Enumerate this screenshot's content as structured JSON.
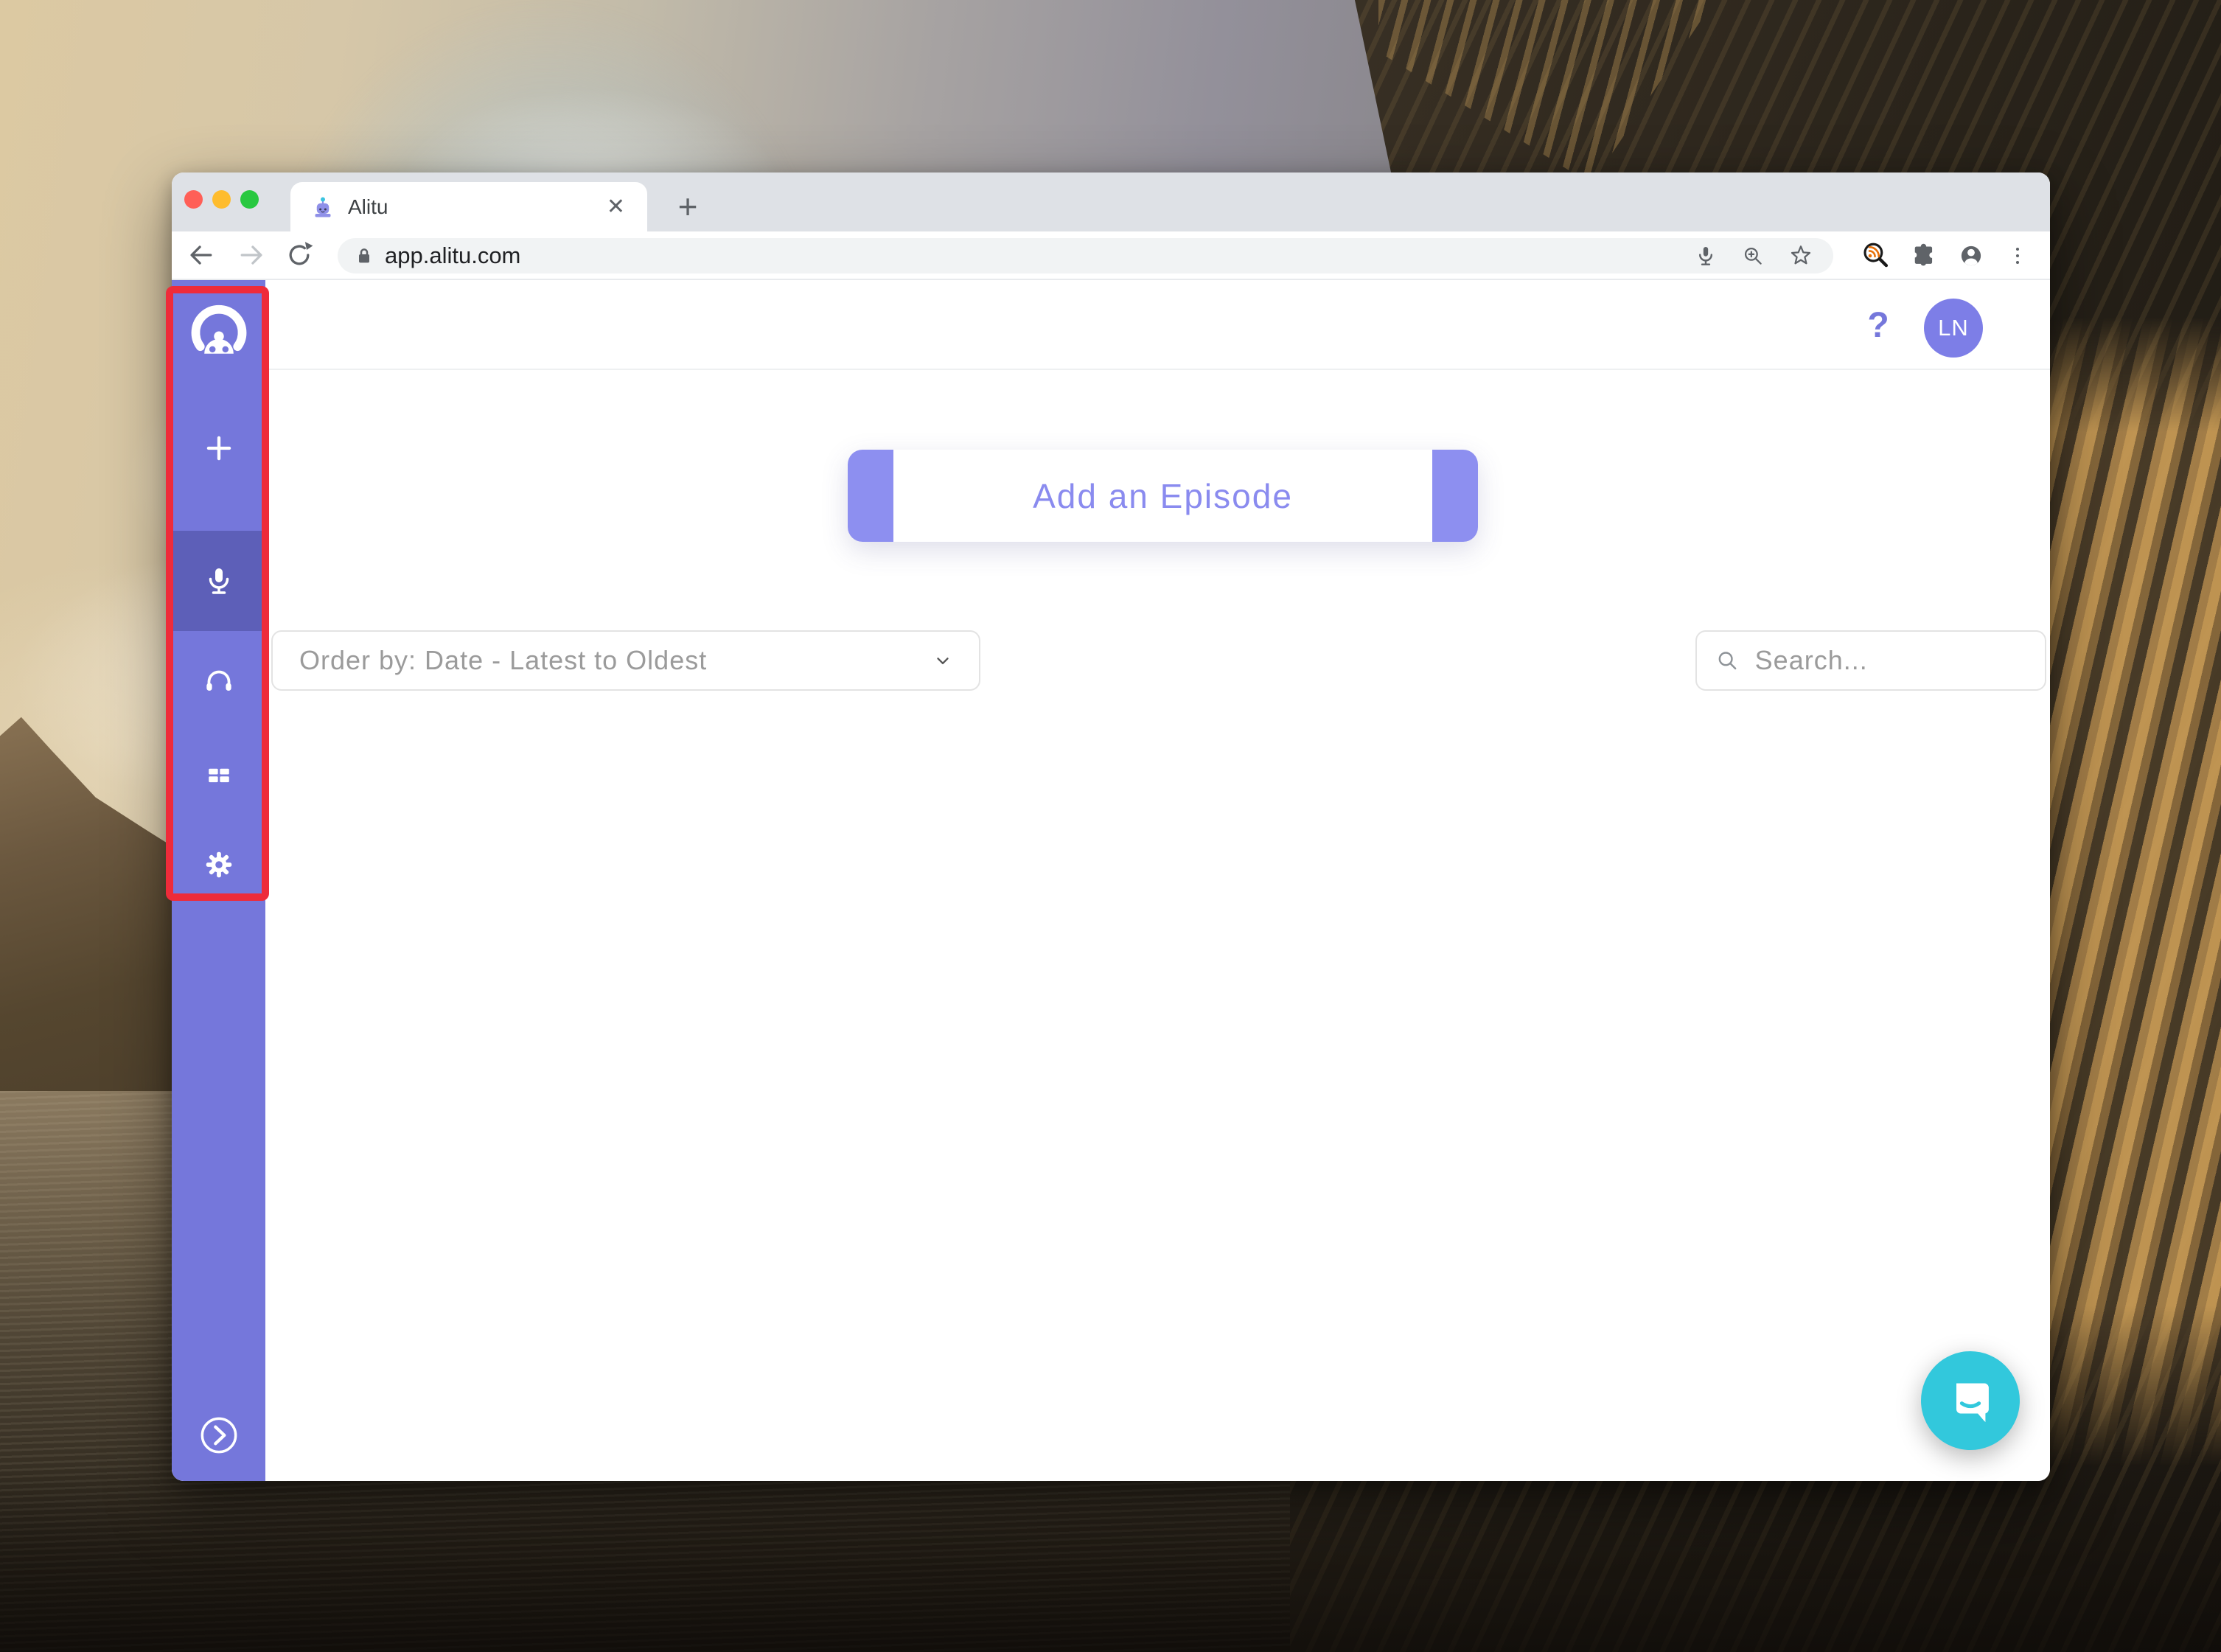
{
  "colors": {
    "accent": "#7577db",
    "accent-dark": "#5d5fb8",
    "accent-cap": "#8d8ff0",
    "accent-text": "#8a8bef",
    "avatar": "#7d7ee7",
    "annotation-red": "#ee2b3a",
    "intercom": "#32c8dc",
    "chrome-strip": "#dee1e6",
    "omnibox": "#f1f3f4",
    "traffic-red": "#ff5f57",
    "traffic-yellow": "#febc2e",
    "traffic-green": "#28c840"
  },
  "browser": {
    "tab": {
      "title": "Alitu",
      "favicon": "alitu-robot-favicon",
      "close_glyph": "✕"
    },
    "new_tab_glyph": "+",
    "url": "app.alitu.com",
    "toolbar_icons": [
      "back-arrow-icon",
      "forward-arrow-icon",
      "reload-icon",
      "lock-icon",
      "mic-icon",
      "zoom-in-icon",
      "bookmark-star-icon",
      "rss-finder-extension-icon",
      "extensions-puzzle-icon",
      "profile-icon",
      "menu-kebab-icon"
    ]
  },
  "app": {
    "header": {
      "help_glyph": "?",
      "avatar_initials": "LN"
    },
    "sidebar": {
      "items": [
        {
          "name": "alitu-logo",
          "icon": "robot-logo-icon",
          "active": false
        },
        {
          "name": "add",
          "icon": "plus-icon",
          "active": false
        },
        {
          "name": "record",
          "icon": "microphone-icon",
          "active": true
        },
        {
          "name": "episodes",
          "icon": "headphones-icon",
          "active": false
        },
        {
          "name": "library",
          "icon": "grid-icon",
          "active": false
        },
        {
          "name": "settings",
          "icon": "gear-icon",
          "active": false
        }
      ],
      "collapse_icon": "chevron-right-icon"
    },
    "main": {
      "add_episode_label": "Add an Episode",
      "order_by_value": "Order by: Date - Latest to Oldest",
      "search_placeholder": "Search..."
    },
    "chat_icon": "intercom-chat-icon"
  },
  "annotation": {
    "type": "red-rectangle-highlight",
    "target": "sidebar-icons"
  }
}
